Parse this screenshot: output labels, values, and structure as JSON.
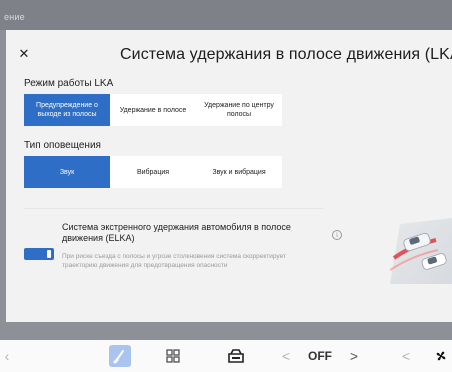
{
  "background_fragment": "ение",
  "header": {
    "title": "Система удержания в полосе движения (LKA)",
    "close_icon": "close-icon"
  },
  "lka_mode": {
    "label": "Режим работы LKA",
    "options": [
      {
        "label": "Предупреждение о выходе из полосы",
        "active": true
      },
      {
        "label": "Удержание в полосе",
        "active": false
      },
      {
        "label": "Удержание по центру полосы",
        "active": false
      }
    ]
  },
  "alert_type": {
    "label": "Тип оповещения",
    "options": [
      {
        "label": "Звук",
        "active": true
      },
      {
        "label": "Вибрация",
        "active": false
      },
      {
        "label": "Звук и вибрация",
        "active": false
      }
    ]
  },
  "elka": {
    "title": "Система экстренного удержания автомобиля в полосе движения (ELKA)",
    "description": "При риске съезда с полосы и угрозе столкновения система скорректирует траекторию движения для предотвращения опасности",
    "enabled": true,
    "info_icon": "info-icon"
  },
  "bottom_bar": {
    "left_arrow_fragment": "‹",
    "fan_value": "OFF",
    "prev_label": "<",
    "next_label": ">",
    "prev2_label": "<"
  },
  "colors": {
    "accent": "#2f6ec6",
    "panel_bg": "#f2f2f2",
    "overlay": "#8d9097"
  }
}
